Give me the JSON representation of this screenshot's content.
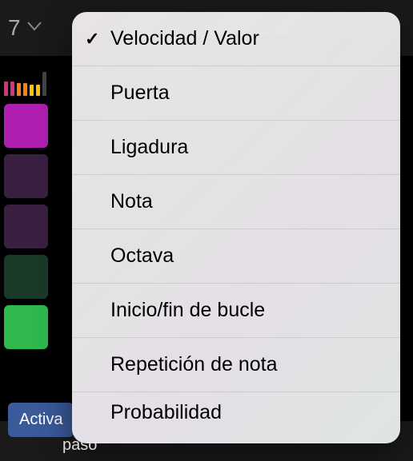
{
  "header": {
    "number": "7"
  },
  "bottom": {
    "buttonLabel": "Activa",
    "belowText": "paso"
  },
  "menu": {
    "items": [
      {
        "label": "Velocidad / Valor",
        "selected": true
      },
      {
        "label": "Puerta",
        "selected": false
      },
      {
        "label": "Ligadura",
        "selected": false
      },
      {
        "label": "Nota",
        "selected": false
      },
      {
        "label": "Octava",
        "selected": false
      },
      {
        "label": "Inicio/fin de bucle",
        "selected": false
      },
      {
        "label": "Repetición de nota",
        "selected": false
      },
      {
        "label": "Probabilidad",
        "selected": false
      }
    ]
  }
}
